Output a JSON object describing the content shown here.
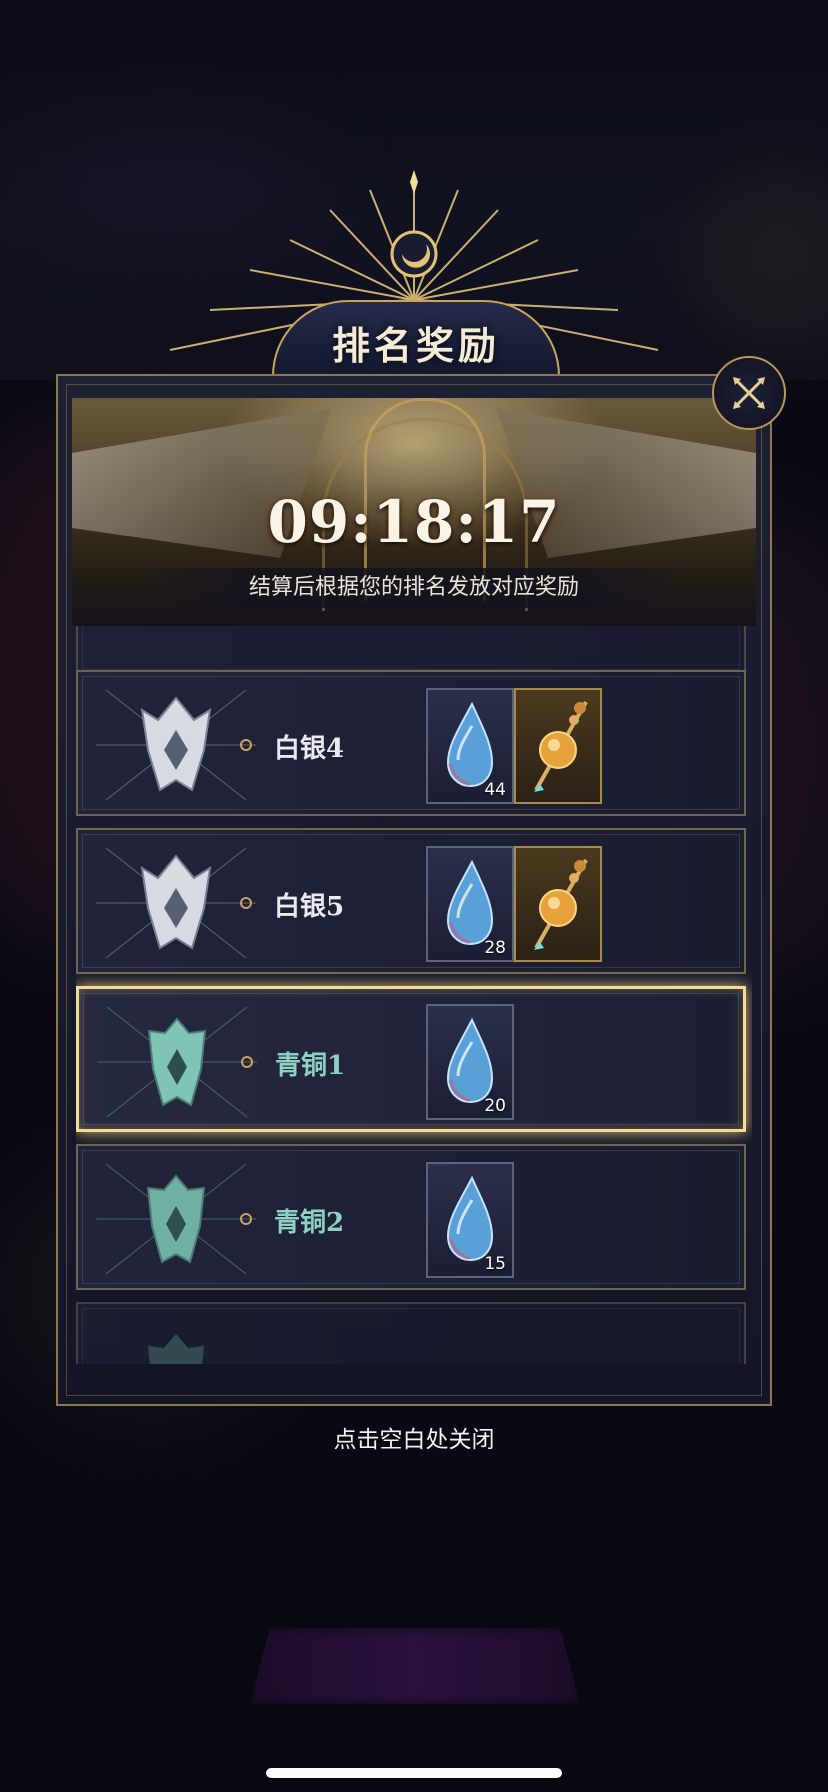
{
  "title": "排名奖励",
  "countdown": "09:18:17",
  "subtitle": "结算后根据您的排名发放对应奖励",
  "close_hint": "点击空白处关闭",
  "colors": {
    "gold": "#c9a45c",
    "silver": "#eaeaf0",
    "bronze": "#8fd2c4",
    "highlight": "#f4dc96"
  },
  "ranks": [
    {
      "name": "白银4",
      "tier": "silver",
      "selected": false,
      "rewards": [
        {
          "icon": "blue-crystal-icon",
          "qty": "44"
        },
        {
          "icon": "golden-potion-icon",
          "qty": ""
        }
      ]
    },
    {
      "name": "白银5",
      "tier": "silver",
      "selected": false,
      "rewards": [
        {
          "icon": "blue-crystal-icon",
          "qty": "28"
        },
        {
          "icon": "golden-potion-icon",
          "qty": ""
        }
      ]
    },
    {
      "name": "青铜1",
      "tier": "bronze",
      "selected": true,
      "rewards": [
        {
          "icon": "blue-crystal-icon",
          "qty": "20"
        }
      ]
    },
    {
      "name": "青铜2",
      "tier": "bronze",
      "selected": false,
      "rewards": [
        {
          "icon": "blue-crystal-icon",
          "qty": "15"
        }
      ]
    }
  ]
}
